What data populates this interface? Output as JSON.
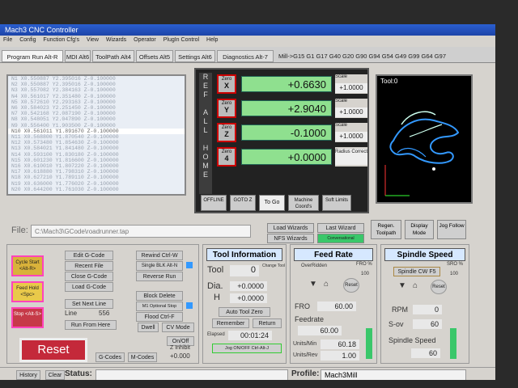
{
  "window": {
    "title": "Mach3 CNC Controller"
  },
  "menu": [
    "File",
    "Config",
    "Function Cfg's",
    "View",
    "Wizards",
    "Operator",
    "PlugIn Control",
    "Help"
  ],
  "tabs": [
    "Program Run Alt-R",
    "MDI Alt6",
    "ToolPath Alt4",
    "Offsets Alt5",
    "Settings Alt6",
    "Diagnostics Alt-7"
  ],
  "active_gcodes": "Mill->G15  G1 G17 G40 G20 G90 G94 G54 G49 G99 G64 G97",
  "gcode_lines": [
    "N1 X0.550887 Y2.395016 Z-0.100000",
    "N2 X0.550887 Y2.395016 Z-0.100000",
    "N3 X0.557082 Y2.384163 Z-0.100000",
    "N4 X0.561017 Y2.351480 Z-0.100000",
    "N5 X0.572610 Y2.293163 Z-0.100000",
    "N6 X0.584023 Y2.251450 Z-0.100000",
    "N7 X0.542168 Y2.087190 Z-0.100000",
    "N8 X0.548051 Y2.047890 Z-0.100000",
    "N9 X0.556400 Y1.903500 Z-0.100000",
    "N10 X0.561011 Y1.891670 Z-0.100000",
    "N11 X0.568800 Y1.870540 Z-0.100000",
    "N12 X0.573480 Y1.854630 Z-0.100000",
    "N13 X0.584021 Y1.841480 Z-0.100000",
    "N14 X0.593100 Y1.830180 Z-0.100000",
    "N15 X0.601230 Y1.816600 Z-0.100000",
    "N16 X0.610010 Y1.807220 Z-0.100000",
    "N17 X0.618880 Y1.798310 Z-0.100000",
    "N18 X0.627210 Y1.789110 Z-0.100000",
    "N19 X0.636000 Y1.776020 Z-0.100000",
    "N20 X0.644200 Y1.761030 Z-0.100000"
  ],
  "dro": {
    "ref_label": "REF ALL HOME",
    "zero_label": "Zero",
    "scale_label": "Scale",
    "axes": [
      {
        "axis": "X",
        "value": "+0.6630",
        "scale": "+1.0000"
      },
      {
        "axis": "Y",
        "value": "+2.9040",
        "scale": "+1.0000"
      },
      {
        "axis": "Z",
        "value": "-0.1000",
        "scale": "+1.0000"
      },
      {
        "axis": "4",
        "value": "+0.0000",
        "scale": "Radius Correct"
      }
    ],
    "buttons": [
      "OFFLINE",
      "GOTO Z",
      "To Go",
      "Machine Coord's",
      "Soft Limits"
    ]
  },
  "toolpath": {
    "label": "Tool:0"
  },
  "file": {
    "label": "File:",
    "path": "C:\\Mach3\\GCode\\roadrunner.tap",
    "load_wizards": "Load Wizards",
    "last_wizard": "Last Wizard",
    "nfs_wizards": "NFS Wizards",
    "conversational": "Conversational",
    "regen": "Regen. Toolpath",
    "display_mode": "Display Mode",
    "jog_follow": "Jog Follow"
  },
  "program_controls": {
    "cycle_start": "Cycle Start <Alt-R>",
    "feed_hold": "Feed Hold <Spc>",
    "stop": "Stop <Alt-S>",
    "edit_gcode": "Edit G-Code",
    "recent_file": "Recent File",
    "close_gcode": "Close G-Code",
    "load_gcode": "Load G-Code",
    "set_next_line": "Set Next Line",
    "line_label": "Line",
    "line_value": "556",
    "run_from_here": "Run From Here",
    "rewind": "Rewind Ctrl-W",
    "single_blk": "Single BLK Alt-N",
    "reverse_run": "Reverse Run",
    "block_delete": "Block Delete",
    "m1_optional": "M1 Optional Stop",
    "flood": "Flood Ctrl-F",
    "dwell": "Dwell",
    "cv_mode": "CV Mode",
    "reset": "Reset",
    "gcodes": "G-Codes",
    "mcodes": "M-Codes",
    "on_off": "On/Off",
    "z_inhibit": "Z Inhibit",
    "z_inhibit_val": "+0.000"
  },
  "tool_info": {
    "title": "Tool Information",
    "tool_label": "Tool",
    "tool_value": "0",
    "change_label": "Change Tool",
    "dia_label": "Dia.",
    "dia_value": "+0.0000",
    "h_label": "H",
    "h_value": "+0.0000",
    "auto_zero": "Auto Tool Zero",
    "remember": "Remember",
    "return": "Return",
    "elapsed_label": "Elapsed",
    "elapsed_value": "00:01:24",
    "jog": "Jog ON/OFF Ctrl-Alt-J"
  },
  "feed": {
    "title": "Feed Rate",
    "overridden": "OverRidden",
    "fro_pct_label": "FRO %",
    "fro_pct_value": "100",
    "reset": "Reset",
    "fro_label": "FRO",
    "fro_value": "60.00",
    "feedrate_label": "Feedrate",
    "feedrate_value": "60.00",
    "units_min_label": "Units/Min",
    "units_min_value": "60.18",
    "units_rev_label": "Units/Rev",
    "units_rev_value": "1.00"
  },
  "spindle": {
    "title": "Spindle Speed",
    "cw": "Spindle CW F5",
    "sro_label": "SRO %",
    "sro_value": "100",
    "reset": "Reset",
    "rpm_label": "RPM",
    "rpm_value": "0",
    "sov_label": "S-ov",
    "sov_value": "60",
    "speed_label": "Spindle Speed",
    "speed_value": "60"
  },
  "status": {
    "history": "History",
    "clear": "Clear",
    "status_label": "Status:",
    "status_value": "",
    "profile_label": "Profile:",
    "profile_value": "Mach3Mill"
  }
}
